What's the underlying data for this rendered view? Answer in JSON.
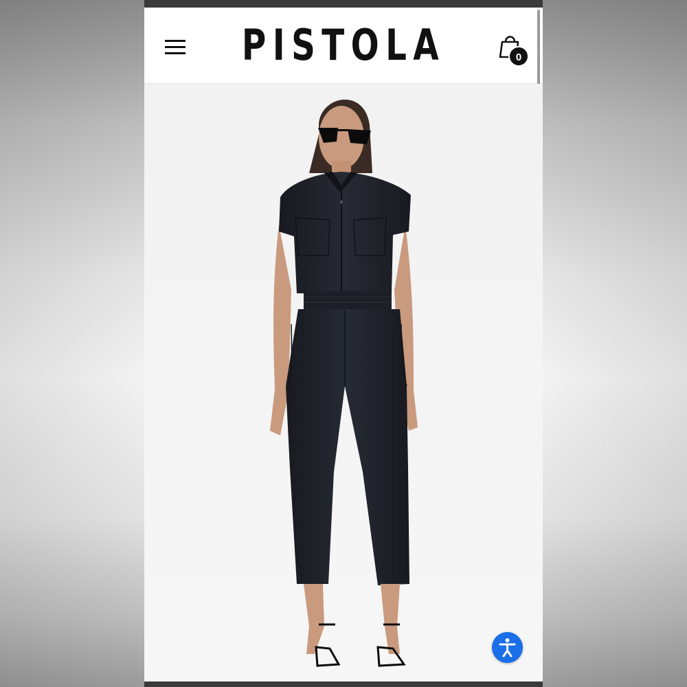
{
  "header": {
    "brand": "PISTOLA",
    "menu_icon": "hamburger-menu-icon",
    "cart_icon": "shopping-bag-icon",
    "cart_count": "0"
  },
  "hero": {
    "image": "model-wearing-black-sleeveless-jumpsuit",
    "garment_color": "#1e2128"
  },
  "accessibility": {
    "icon": "accessibility-person-icon",
    "color": "#1a6fe8"
  }
}
